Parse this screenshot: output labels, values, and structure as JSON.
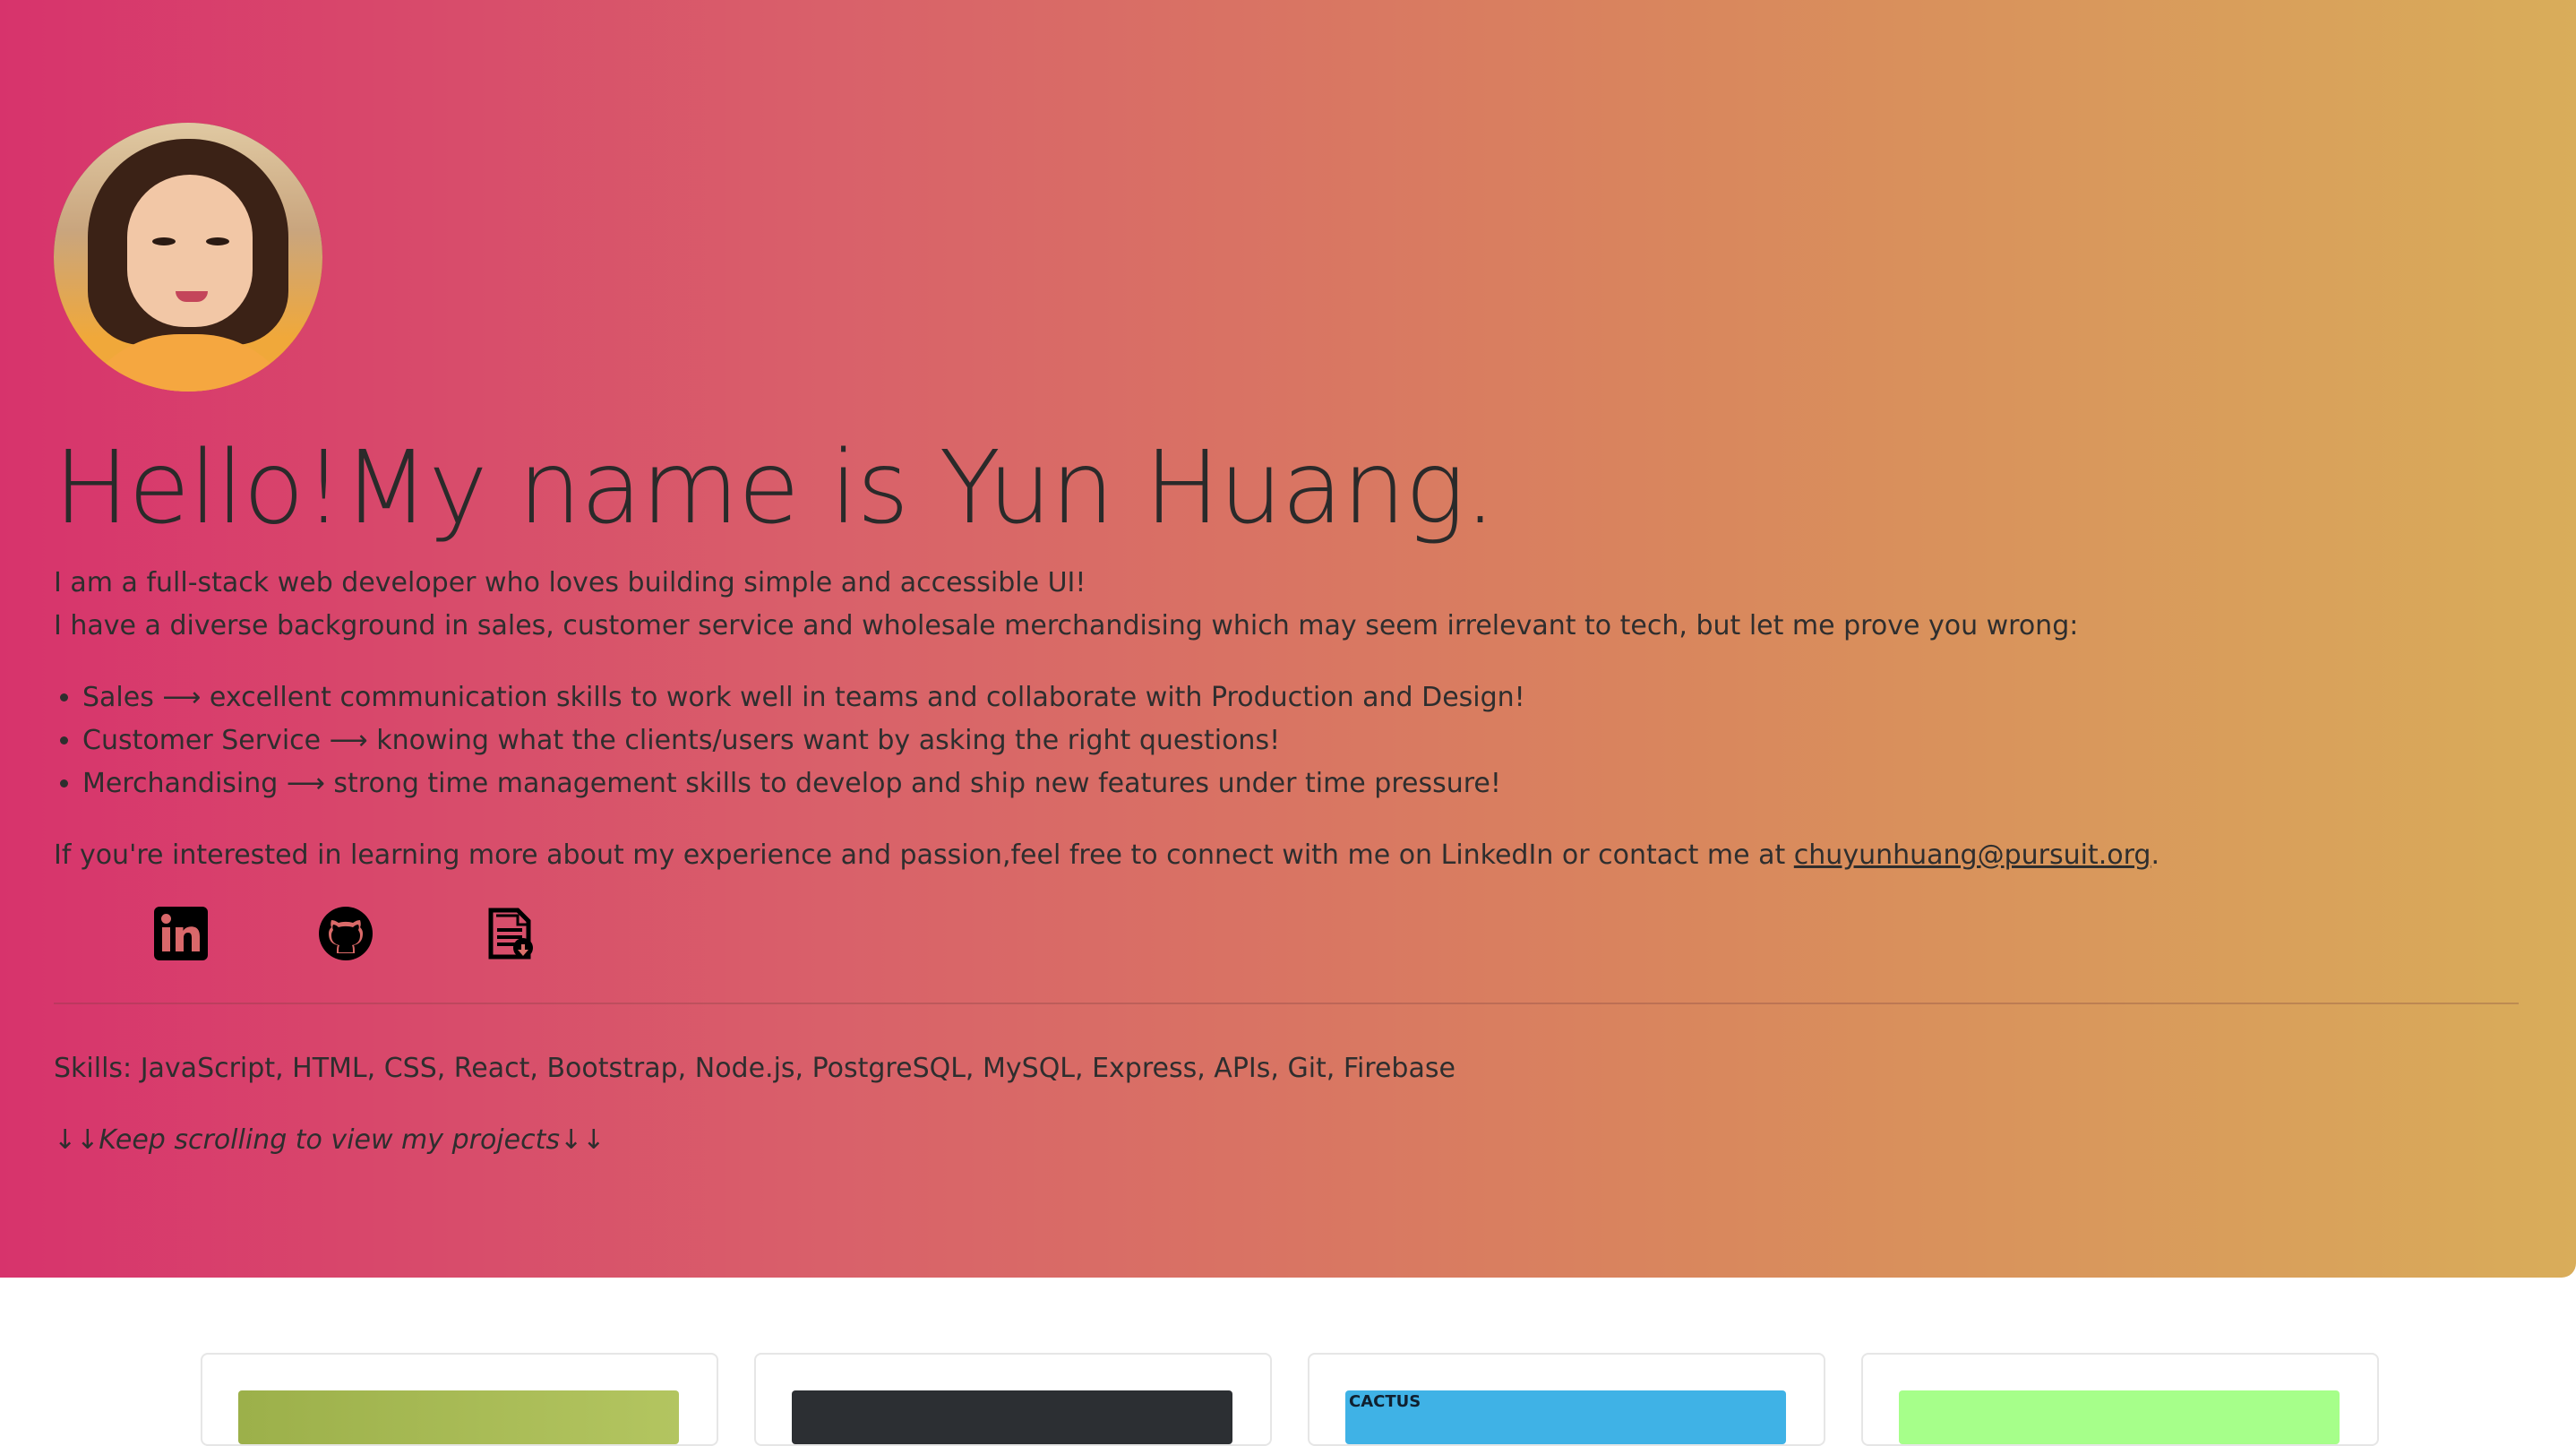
{
  "profile": {
    "headline": "Hello!My name is Yun Huang.",
    "intro_line1": "I am a full-stack web developer who loves building simple and accessible UI!",
    "intro_line2": "I have a diverse background in sales, customer service and wholesale merchandising which may seem irrelevant to tech, but let me prove you wrong:"
  },
  "bullets": [
    "Sales ⟶ excellent communication skills to work well in teams and collaborate with Production and Design!",
    "Customer Service ⟶ knowing what the clients/users want by asking the right questions!",
    "Merchandising ⟶ strong time management skills to develop and ship new features under time pressure!"
  ],
  "contact": {
    "prefix": "If you're interested in learning more about my experience and passion,feel free to connect with me on LinkedIn or contact me at ",
    "email": "chuyunhuang@pursuit.org",
    "suffix": "."
  },
  "social_icons": [
    "linkedin-icon",
    "github-icon",
    "resume-icon"
  ],
  "skills": "Skills: JavaScript, HTML, CSS, React, Bootstrap, Node.js, PostgreSQL, MySQL, Express, APIs, Git, Firebase",
  "scroll_hint": "↓↓Keep scrolling to view my projects↓↓",
  "projects": [
    {
      "thumb_text": ""
    },
    {
      "thumb_text": ""
    },
    {
      "thumb_text": "CACTUS"
    },
    {
      "thumb_text": ""
    }
  ],
  "colors": {
    "gradient_start": "#d7336c",
    "gradient_end": "#d9ad5a",
    "text": "#2e2e2e"
  }
}
